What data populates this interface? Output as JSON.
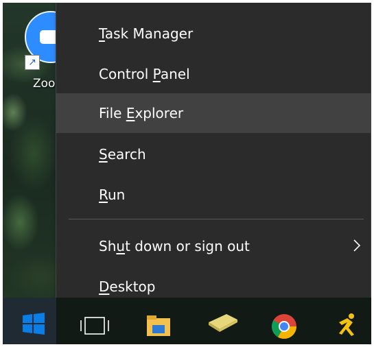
{
  "desktop": {
    "icon_label": "Zoom",
    "icon_name": "zoom-icon"
  },
  "menu": {
    "items": [
      {
        "pre": "",
        "u": "T",
        "post": "ask Manager",
        "name": "task-manager"
      },
      {
        "pre": "Control ",
        "u": "P",
        "post": "anel",
        "name": "control-panel"
      },
      {
        "pre": "File ",
        "u": "E",
        "post": "xplorer",
        "name": "file-explorer",
        "highlighted": true
      },
      {
        "pre": "",
        "u": "S",
        "post": "earch",
        "name": "search"
      },
      {
        "pre": "",
        "u": "R",
        "post": "un",
        "name": "run"
      },
      {
        "pre": "Sh",
        "u": "u",
        "post": "t down or sign out",
        "name": "shut-down-or-sign-out",
        "has_submenu": true
      },
      {
        "pre": "",
        "u": "D",
        "post": "esktop",
        "name": "desktop"
      }
    ]
  },
  "taskbar": {
    "icons": [
      "windows-start-icon",
      "task-view-icon",
      "file-explorer-icon",
      "sticky-notes-icon",
      "chrome-icon",
      "runner-app-icon"
    ]
  },
  "colors": {
    "menu_bg": "#2b2b2b",
    "menu_hover": "#414141",
    "text": "#ffffff",
    "start_blue": "#0a7ee6"
  }
}
